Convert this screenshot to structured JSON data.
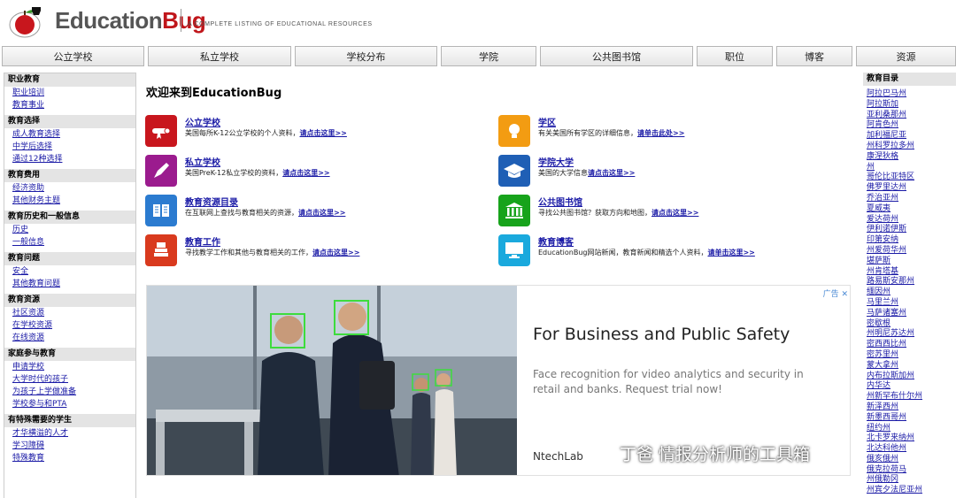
{
  "header": {
    "logo_edu": "Education",
    "logo_bug": "Bug",
    "tagline": "A COMPLETE LISTING OF EDUCATIONAL RESOURCES"
  },
  "nav": [
    "公立学校",
    "私立学校",
    "学校分布",
    "学院",
    "公共图书馆",
    "职位",
    "博客",
    "资源"
  ],
  "left_sidebar": [
    {
      "title": "职业教育",
      "links": [
        "职业培训",
        "教育事业"
      ]
    },
    {
      "title": "教育选择",
      "links": [
        "成人教育选择",
        "中学后选择",
        "通过12种选择"
      ]
    },
    {
      "title": "教育费用",
      "links": [
        "经济资助",
        "其他财务主题"
      ]
    },
    {
      "title": "教育历史和一般信息",
      "links": [
        "历史",
        "一般信息"
      ]
    },
    {
      "title": "教育问题",
      "links": [
        "安全",
        "其他教育问题"
      ]
    },
    {
      "title": "教育资源",
      "links": [
        "社区资源",
        "在学校资源",
        "在线资源"
      ]
    },
    {
      "title": "家庭参与教育",
      "links": [
        "申请学校",
        "大学时代的孩子",
        "为孩子上学做准备",
        "学校参与和PTA"
      ]
    },
    {
      "title": "有特殊需要的学生",
      "links": [
        "才华横溢的人才",
        "学习障碍",
        "特殊教育"
      ]
    }
  ],
  "main": {
    "welcome": "欢迎来到EducationBug",
    "features": [
      {
        "title": "公立学校",
        "desc": "美国每所K-12公立学校的个人资料，",
        "link": "请点击这里>>",
        "color": "#c8161d",
        "icon": "diploma-icon"
      },
      {
        "title": "学区",
        "desc": "有关美国所有学区的详细信息，",
        "link": "请单击此处>>",
        "color": "#f39c12",
        "icon": "lightbulb-icon"
      },
      {
        "title": "私立学校",
        "desc": "美国PreK-12私立学校的资料，",
        "link": "请点击这里>>",
        "color": "#9b1b8e",
        "icon": "pen-icon"
      },
      {
        "title": "学院大学",
        "desc": "美国的大学信息",
        "link": "请点击这里>>",
        "color": "#1f5fb5",
        "icon": "graduation-cap-icon"
      },
      {
        "title": "教育资源目录",
        "desc": "在互联网上查找与教育相关的资源，",
        "link": "请点击这里>>",
        "color": "#2b7bd0",
        "icon": "book-icon"
      },
      {
        "title": "公共图书馆",
        "desc": "寻找公共图书馆？获取方向和地图，",
        "link": "请点击这里>>",
        "color": "#17a31b",
        "icon": "library-icon"
      },
      {
        "title": "教育工作",
        "desc": "寻找教学工作和其他与教育相关的工作，",
        "link": "请点击这里>>",
        "color": "#d93a1e",
        "icon": "books-stack-icon"
      },
      {
        "title": "教育博客",
        "desc": "EducationBug网站新闻，教育新闻和精选个人资料，",
        "link": "请单击这里>>",
        "color": "#1aa9dd",
        "icon": "monitor-icon"
      }
    ]
  },
  "ad": {
    "headline": "For Business and Public Safety",
    "sub": "Face recognition for video analytics and security in retail and banks. Request trial now!",
    "brand": "NtechLab",
    "mark": "广告 ✕"
  },
  "watermark": "丁爸 情报分析师的工具箱",
  "right_sidebar": {
    "title": "教育目录",
    "links": [
      "阿拉巴马州",
      "阿拉斯加",
      "亚利桑那州",
      "阿肯色州",
      "加利福尼亚",
      "州科罗拉多州",
      "康涅狄格",
      "州",
      "哥伦比亚特区",
      "佛罗里达州",
      "乔治亚州",
      "夏威夷",
      "爱达荷州",
      "伊利诺伊斯",
      "印第安纳",
      "州爱荷华州",
      "堪萨斯",
      "州肯塔基",
      "路易斯安那州",
      "缅因州",
      "马里兰州",
      "马萨诸塞州",
      "密歇根",
      "州明尼苏达州",
      "密西西比州",
      "密苏里州",
      "蒙大拿州",
      "内布拉斯加州",
      "内华达",
      "州新罕布什尔州",
      "新泽西州",
      "新墨西哥州",
      "纽约州",
      "北卡罗来纳州",
      "北达科他州",
      "俄亥俄州",
      "俄克拉荷马",
      "州俄勒冈",
      "州宾夕法尼亚州"
    ]
  }
}
